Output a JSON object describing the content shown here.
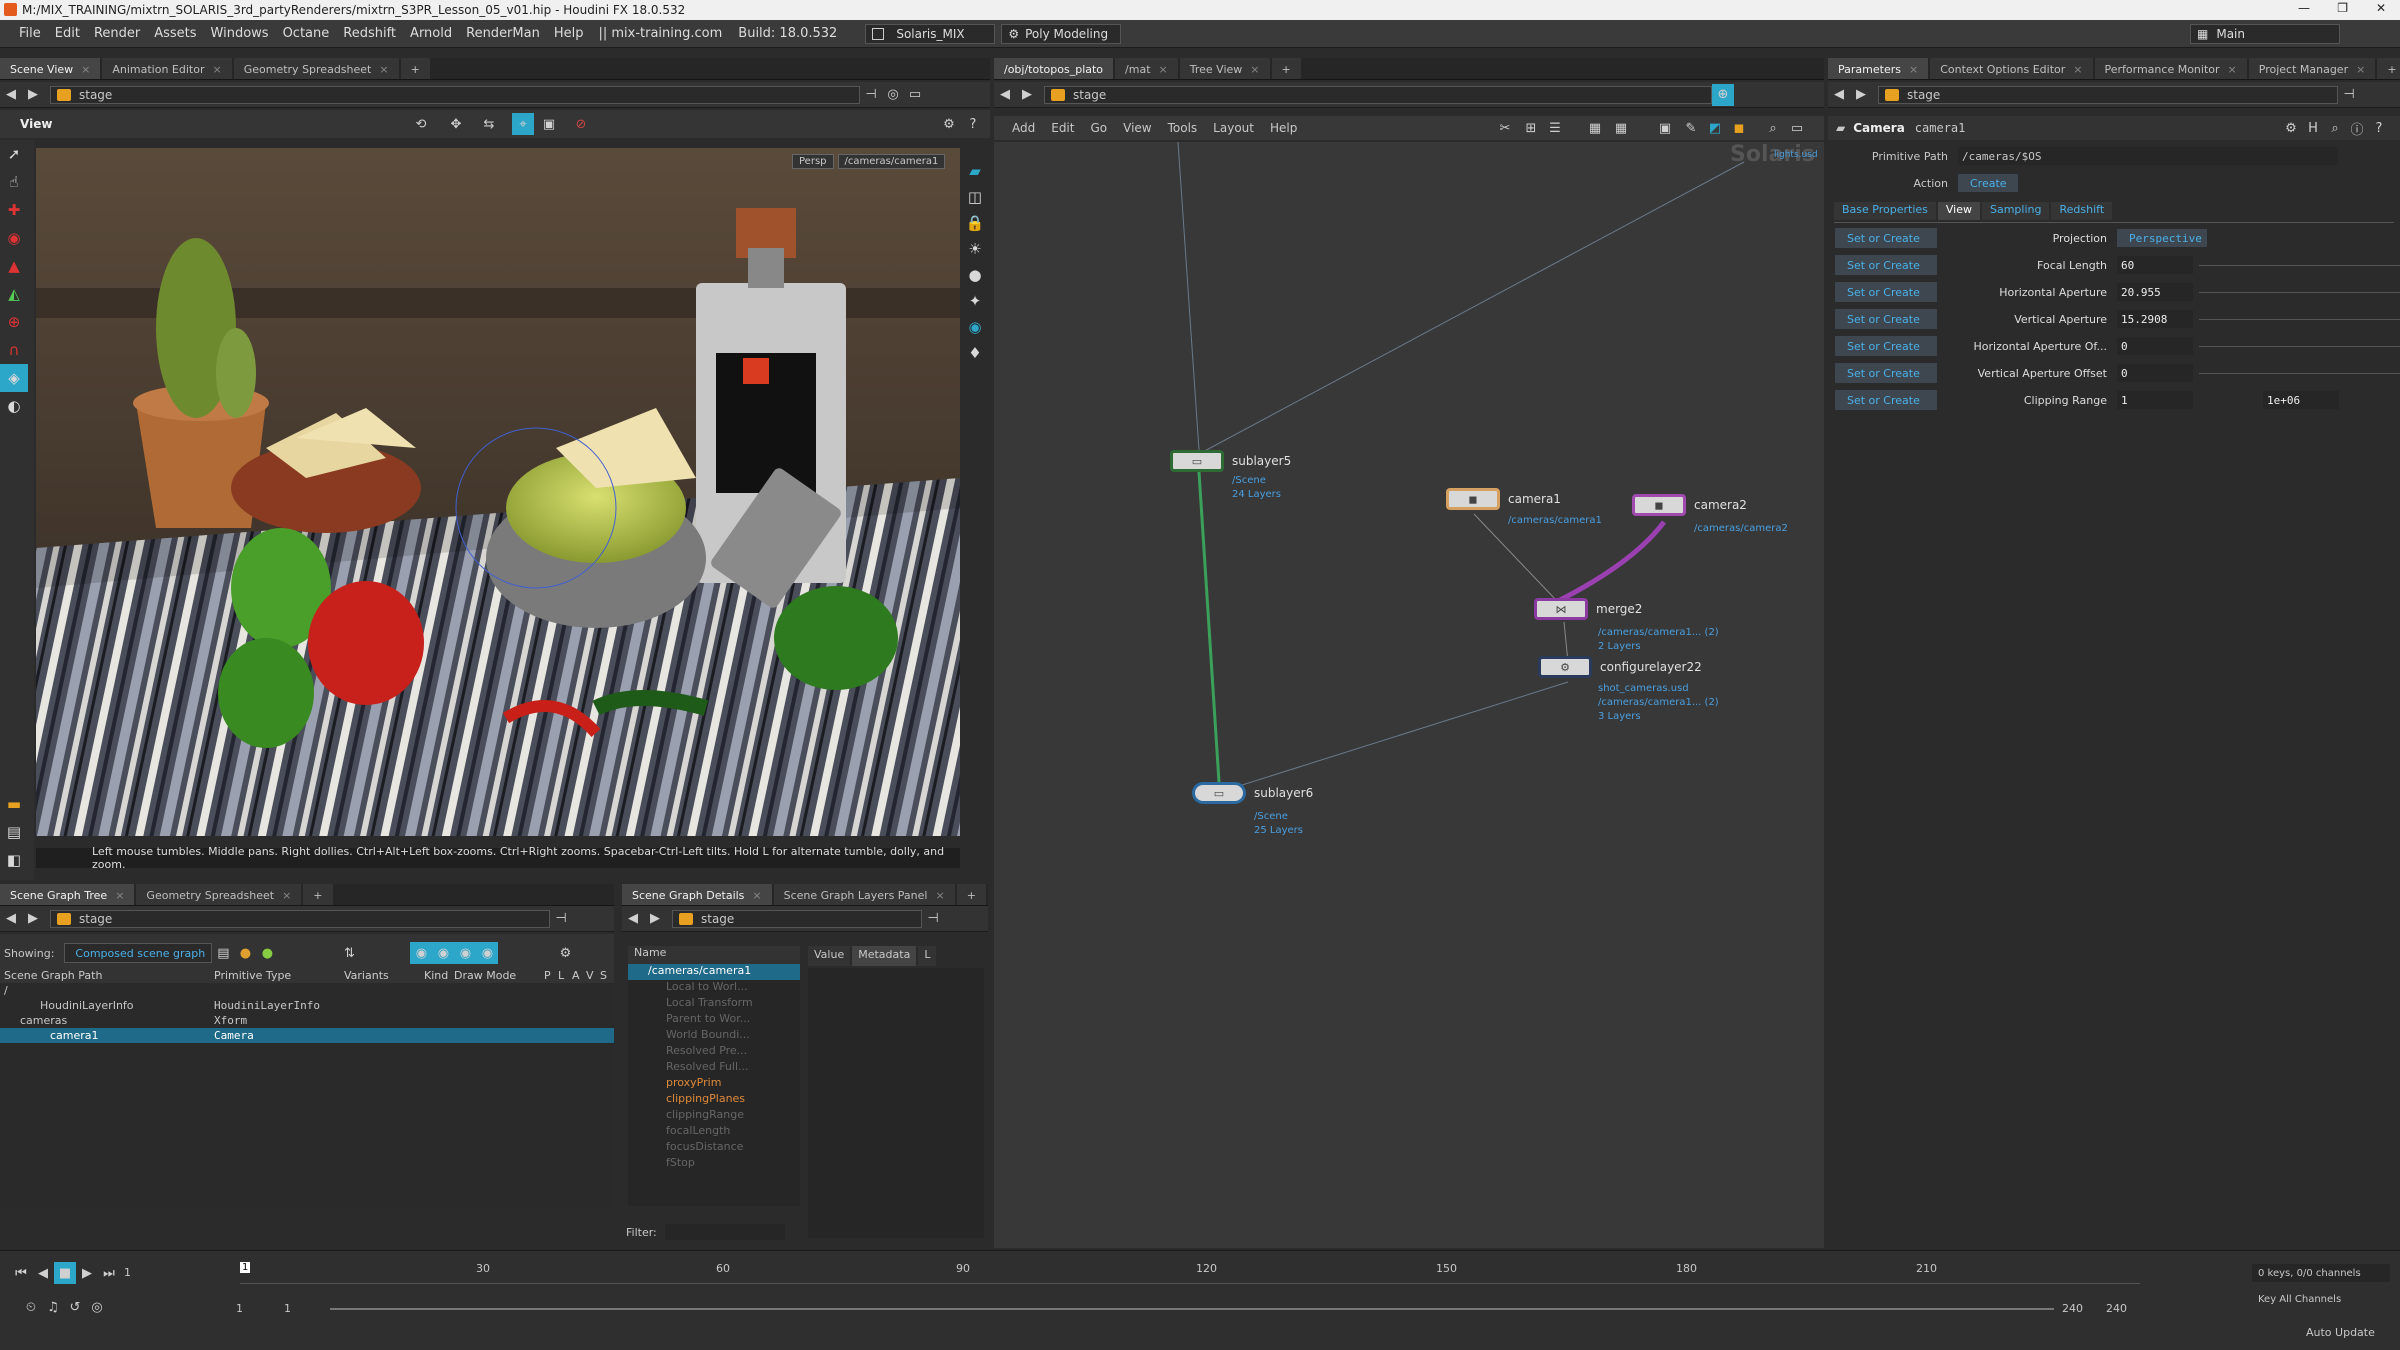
{
  "window": {
    "title": "M:/MIX_TRAINING/mixtrn_SOLARIS_3rd_partyRenderers/mixtrn_S3PR_Lesson_05_v01.hip - Houdini FX 18.0.532"
  },
  "menubar": {
    "items": [
      "File",
      "Edit",
      "Render",
      "Assets",
      "Windows",
      "Octane",
      "Redshift",
      "Arnold",
      "RenderMan",
      "Help"
    ],
    "site": "|| mix-training.com",
    "build": "Build: 18.0.532",
    "desktop": "Solaris_MIX",
    "mode": "Poly Modeling",
    "main": "Main"
  },
  "left_top": {
    "tabs": [
      "Scene View",
      "Animation Editor",
      "Geometry Spreadsheet"
    ],
    "path": "stage",
    "view_label": "View",
    "persp": "Persp",
    "camera": "/cameras/camera1",
    "help_text": "Left mouse tumbles. Middle pans. Right dollies. Ctrl+Alt+Left box-zooms. Ctrl+Right zooms. Spacebar-Ctrl-Left tilts. Hold L for alternate tumble, dolly, and zoom."
  },
  "network": {
    "tabs": [
      "/obj/totopos_plato",
      "/mat",
      "Tree View"
    ],
    "path": "stage",
    "menu": [
      "Add",
      "Edit",
      "Go",
      "View",
      "Tools",
      "Layout",
      "Help"
    ],
    "watermark": "Solaris",
    "lights_label": "lights.usd",
    "nodes": {
      "sublayer5": {
        "name": "sublayer5",
        "sub1": "/Scene",
        "sub2": "24 Layers"
      },
      "camera1": {
        "name": "camera1",
        "sub1": "/cameras/camera1"
      },
      "camera2": {
        "name": "camera2",
        "sub1": "/cameras/camera2"
      },
      "merge2": {
        "name": "merge2",
        "sub1": "/cameras/camera1... (2)",
        "sub2": "2 Layers"
      },
      "configurelayer22": {
        "name": "configurelayer22",
        "sub1": "shot_cameras.usd",
        "sub2": "/cameras/camera1... (2)",
        "sub3": "3 Layers"
      },
      "sublayer6": {
        "name": "sublayer6",
        "sub1": "/Scene",
        "sub2": "25 Layers"
      }
    }
  },
  "params": {
    "tabs": [
      "Parameters",
      "Context Options Editor",
      "Performance Monitor",
      "Project Manager"
    ],
    "path": "stage",
    "op_type": "Camera",
    "op_name": "camera1",
    "primitive_path_label": "Primitive Path",
    "primitive_path": "/cameras/$OS",
    "action_label": "Action",
    "action": "Create",
    "ptabs": [
      "Base Properties",
      "View",
      "Sampling",
      "Redshift"
    ],
    "rows": [
      {
        "soc": "Set or Create",
        "label": "Projection",
        "value": "Perspective"
      },
      {
        "soc": "Set or Create",
        "label": "Focal Length",
        "value": "60"
      },
      {
        "soc": "Set or Create",
        "label": "Horizontal Aperture",
        "value": "20.955"
      },
      {
        "soc": "Set or Create",
        "label": "Vertical Aperture",
        "value": "15.2908"
      },
      {
        "soc": "Set or Create",
        "label": "Horizontal Aperture Of...",
        "value": "0"
      },
      {
        "soc": "Set or Create",
        "label": "Vertical Aperture Offset",
        "value": "0"
      },
      {
        "soc": "Set or Create",
        "label": "Clipping Range",
        "value": "1",
        "value2": "1e+06"
      }
    ]
  },
  "scenegraph": {
    "tabs": [
      "Scene Graph Tree",
      "Geometry Spreadsheet"
    ],
    "path": "stage",
    "showing_label": "Showing:",
    "showing": "Composed scene graph",
    "cols": [
      "Scene Graph Path",
      "Primitive Type",
      "Variants",
      "Kind",
      "Draw Mode",
      "P",
      "L",
      "A",
      "V",
      "S"
    ],
    "rows": [
      {
        "path": "/",
        "type": ""
      },
      {
        "path": "HoudiniLayerInfo",
        "type": "HoudiniLayerInfo"
      },
      {
        "path": "cameras",
        "type": "Xform"
      },
      {
        "path": "camera1",
        "type": "Camera"
      }
    ]
  },
  "layers": {
    "tabs": [
      "Scene Graph Details",
      "Scene Graph Layers Panel"
    ],
    "path": "stage",
    "name_col": "Name",
    "value_col": "Value",
    "metadata_col": "Metadata",
    "l_col": "L",
    "root": "/cameras/camera1",
    "items": [
      "Local to Worl...",
      "Local Transform",
      "Parent to Wor...",
      "World Boundi...",
      "Resolved Pre...",
      "Resolved Full...",
      "proxyPrim",
      "clippingPlanes",
      "clippingRange",
      "focalLength",
      "focusDistance",
      "fStop"
    ],
    "filter_label": "Filter:"
  },
  "timeline": {
    "frame": "1",
    "start": "1",
    "start2": "1",
    "end": "240",
    "end2": "240",
    "ticks": [
      "30",
      "60",
      "90",
      "120",
      "150",
      "180",
      "210"
    ],
    "keys": "0 keys, 0/0 channels",
    "key_all": "Key All Channels",
    "auto_update": "Auto Update"
  }
}
